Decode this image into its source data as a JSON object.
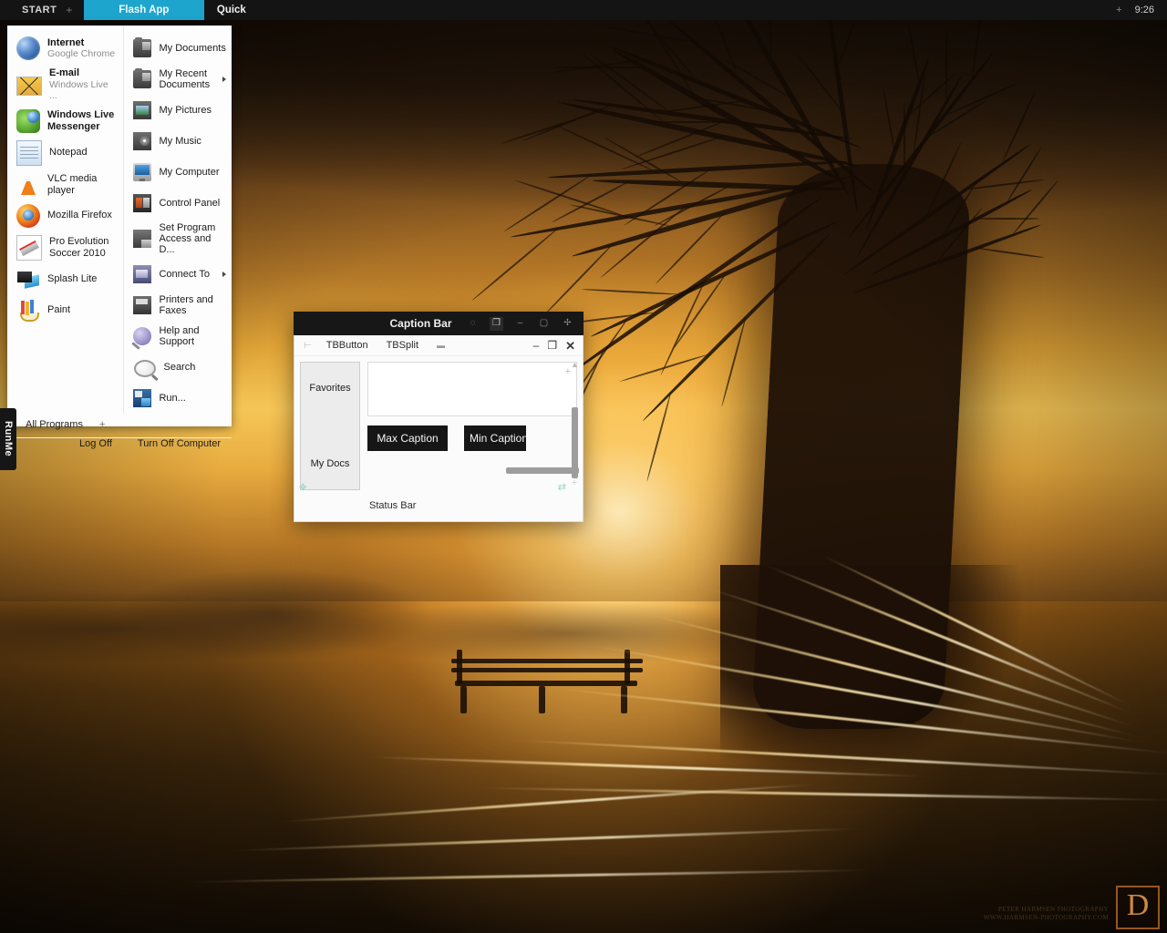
{
  "taskbar": {
    "start_label": "START",
    "start_plus": "+",
    "tabs": [
      {
        "label": "Flash App",
        "active": true
      },
      {
        "label": "Quick",
        "active": false
      }
    ],
    "tray_icon": "+",
    "clock": "9:26"
  },
  "start_menu": {
    "left_items": [
      {
        "title": "Internet",
        "sub": "Google Chrome",
        "icon": "globe-icon"
      },
      {
        "title": "E-mail",
        "sub": "Windows Live ...",
        "icon": "mail-icon"
      },
      {
        "title": "Windows Live Messenger",
        "sub": "",
        "icon": "messenger-icon"
      },
      {
        "title": "Notepad",
        "sub": "",
        "icon": "notepad-icon"
      },
      {
        "title": "VLC media player",
        "sub": "",
        "icon": "vlc-icon"
      },
      {
        "title": "Mozilla Firefox",
        "sub": "",
        "icon": "firefox-icon"
      },
      {
        "title": "Pro Evolution Soccer 2010",
        "sub": "",
        "icon": "pes-icon"
      },
      {
        "title": "Splash Lite",
        "sub": "",
        "icon": "splash-icon"
      },
      {
        "title": "Paint",
        "sub": "",
        "icon": "paint-icon"
      }
    ],
    "right_items": [
      {
        "label": "My Documents",
        "icon": "documents-folder-icon",
        "arrow": false
      },
      {
        "label": "My Recent Documents",
        "icon": "recent-documents-folder-icon",
        "arrow": true
      },
      {
        "label": "My Pictures",
        "icon": "pictures-folder-icon",
        "arrow": false
      },
      {
        "label": "My Music",
        "icon": "music-folder-icon",
        "arrow": false
      },
      {
        "label": "My Computer",
        "icon": "my-computer-icon",
        "arrow": false
      },
      {
        "label": "Control Panel",
        "icon": "control-panel-icon",
        "arrow": false
      },
      {
        "label": "Set Program Access and D...",
        "icon": "set-program-access-icon",
        "arrow": false
      },
      {
        "label": "Connect To",
        "icon": "connect-to-icon",
        "arrow": true
      },
      {
        "label": "Printers and Faxes",
        "icon": "printers-faxes-icon",
        "arrow": false
      },
      {
        "label": "Help and Support",
        "icon": "help-support-icon",
        "arrow": false
      },
      {
        "label": "Search",
        "icon": "search-icon",
        "arrow": false
      },
      {
        "label": "Run...",
        "icon": "run-icon",
        "arrow": false
      }
    ],
    "all_programs": "All Programs",
    "all_programs_plus": "+",
    "log_off": "Log Off",
    "turn_off": "Turn Off Computer"
  },
  "runme_tab": {
    "label": "RunMe"
  },
  "app_window": {
    "caption_title": "Caption Bar",
    "caption_buttons": [
      {
        "glyph": "◌",
        "name": "help-icon"
      },
      {
        "glyph": "❐",
        "name": "restore-icon",
        "highlight": true
      },
      {
        "glyph": "–",
        "name": "minimize-icon"
      },
      {
        "glyph": "▢",
        "name": "maximize-icon"
      },
      {
        "glyph": "✢",
        "name": "close-icon"
      }
    ],
    "toolbar": {
      "grip": "⊢",
      "tb_button": "TBButton",
      "tb_split": "TBSplit",
      "dots": "▬"
    },
    "window_buttons": [
      {
        "glyph": "–",
        "name": "window-minimize-icon"
      },
      {
        "glyph": "❐",
        "name": "window-restore-icon"
      },
      {
        "glyph": "✕",
        "name": "window-close-icon"
      }
    ],
    "side_panel": [
      {
        "label": "Favorites"
      },
      {
        "label": "My Docs"
      }
    ],
    "edit_box_value": "",
    "edit_box_plus": "+",
    "buttons": [
      {
        "label": "Max Caption",
        "clipped": false
      },
      {
        "label": "Min Caption",
        "clipped": true
      }
    ],
    "status_bar": "Status Bar",
    "status_left_icon": "✥",
    "status_right_icon": "⇄",
    "status_plus": "+"
  },
  "watermark": {
    "line1": "PETER HARMSEN PHOTOGRAPHY",
    "line2": "WWW.HARMSEN-PHOTOGRAPHY.COM",
    "logo": "D"
  },
  "colors": {
    "accent": "#1ea5cd",
    "taskbar_bg": "#141414",
    "menu_bg": "#fdfdfd",
    "button_bg": "#161616"
  }
}
